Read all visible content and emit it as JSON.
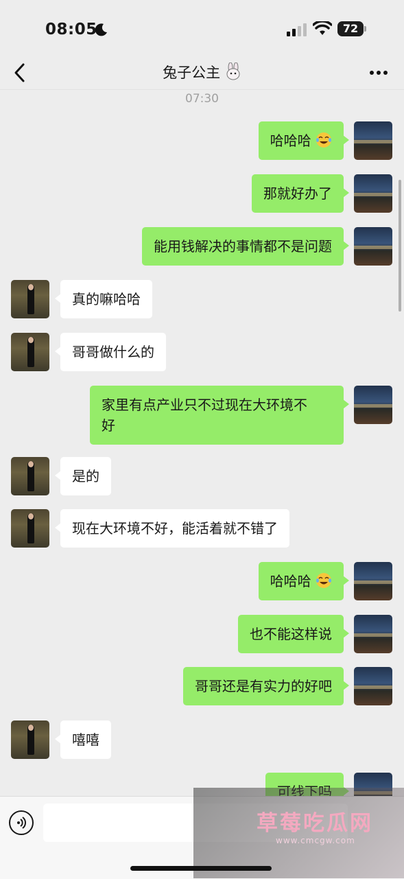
{
  "status_bar": {
    "time": "08:05",
    "battery": "72"
  },
  "chat": {
    "title": "兔子公主",
    "timestamp": "07:30"
  },
  "messages": [
    {
      "from": "me",
      "text": "哈哈哈",
      "emoji": "laughing-tears"
    },
    {
      "from": "me",
      "text": "那就好办了"
    },
    {
      "from": "me",
      "text": "能用钱解决的事情都不是问题"
    },
    {
      "from": "her",
      "text": "真的嘛哈哈"
    },
    {
      "from": "her",
      "text": "哥哥做什么的"
    },
    {
      "from": "me",
      "line1": "家里有点产业只不过现在大环境不",
      "line2": "好"
    },
    {
      "from": "her",
      "text": "是的"
    },
    {
      "from": "her",
      "text": "现在大环境不好，能活着就不错了"
    },
    {
      "from": "me",
      "text": "哈哈哈",
      "emoji": "laughing-tears"
    },
    {
      "from": "me",
      "text": "也不能这样说"
    },
    {
      "from": "me",
      "text": "哥哥还是有实力的好吧"
    },
    {
      "from": "her",
      "text": "嘻嘻"
    },
    {
      "from": "me",
      "text": "可线下吗"
    }
  ],
  "watermark": {
    "text": "草莓吃瓜网",
    "url": "www.cmcgw.com"
  },
  "colors": {
    "outgoing_bubble": "#95ec69",
    "incoming_bubble": "#ffffff",
    "background": "#ededed"
  }
}
